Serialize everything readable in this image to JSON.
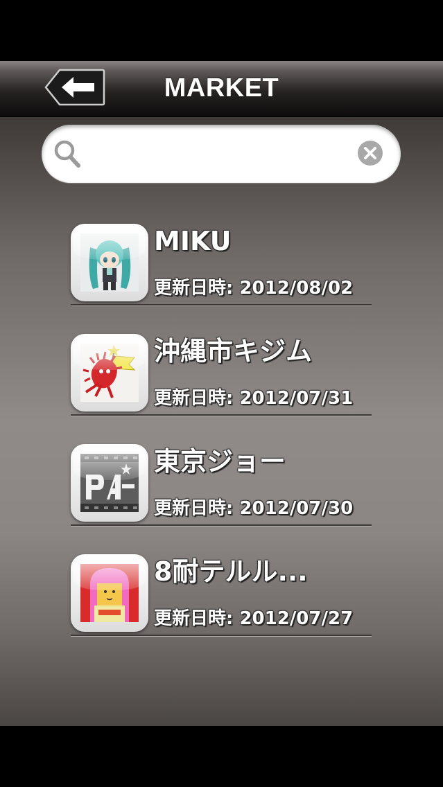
{
  "header": {
    "title": "MARKET",
    "back_icon": "back-arrow-icon"
  },
  "search": {
    "placeholder": "",
    "value": "",
    "search_icon": "magnifier-icon",
    "clear_icon": "clear-x-icon"
  },
  "items": [
    {
      "name": "MIKU",
      "updated": "更新日時: 2012/08/02",
      "thumbnail": "miku-character-thumbnail"
    },
    {
      "name": "沖縄市キジム",
      "updated": "更新日時: 2012/07/31",
      "thumbnail": "red-kijimuna-character-thumbnail"
    },
    {
      "name": "東京ジョー",
      "updated": "更新日時: 2012/07/30",
      "thumbnail": "pa-logo-thumbnail"
    },
    {
      "name": "8耐テルル...",
      "updated": "更新日時: 2012/07/27",
      "thumbnail": "teruru-character-thumbnail"
    }
  ],
  "colors": {
    "header_bg": "#1a1818",
    "content_bg": "#8e8987",
    "text": "#ffffff"
  }
}
